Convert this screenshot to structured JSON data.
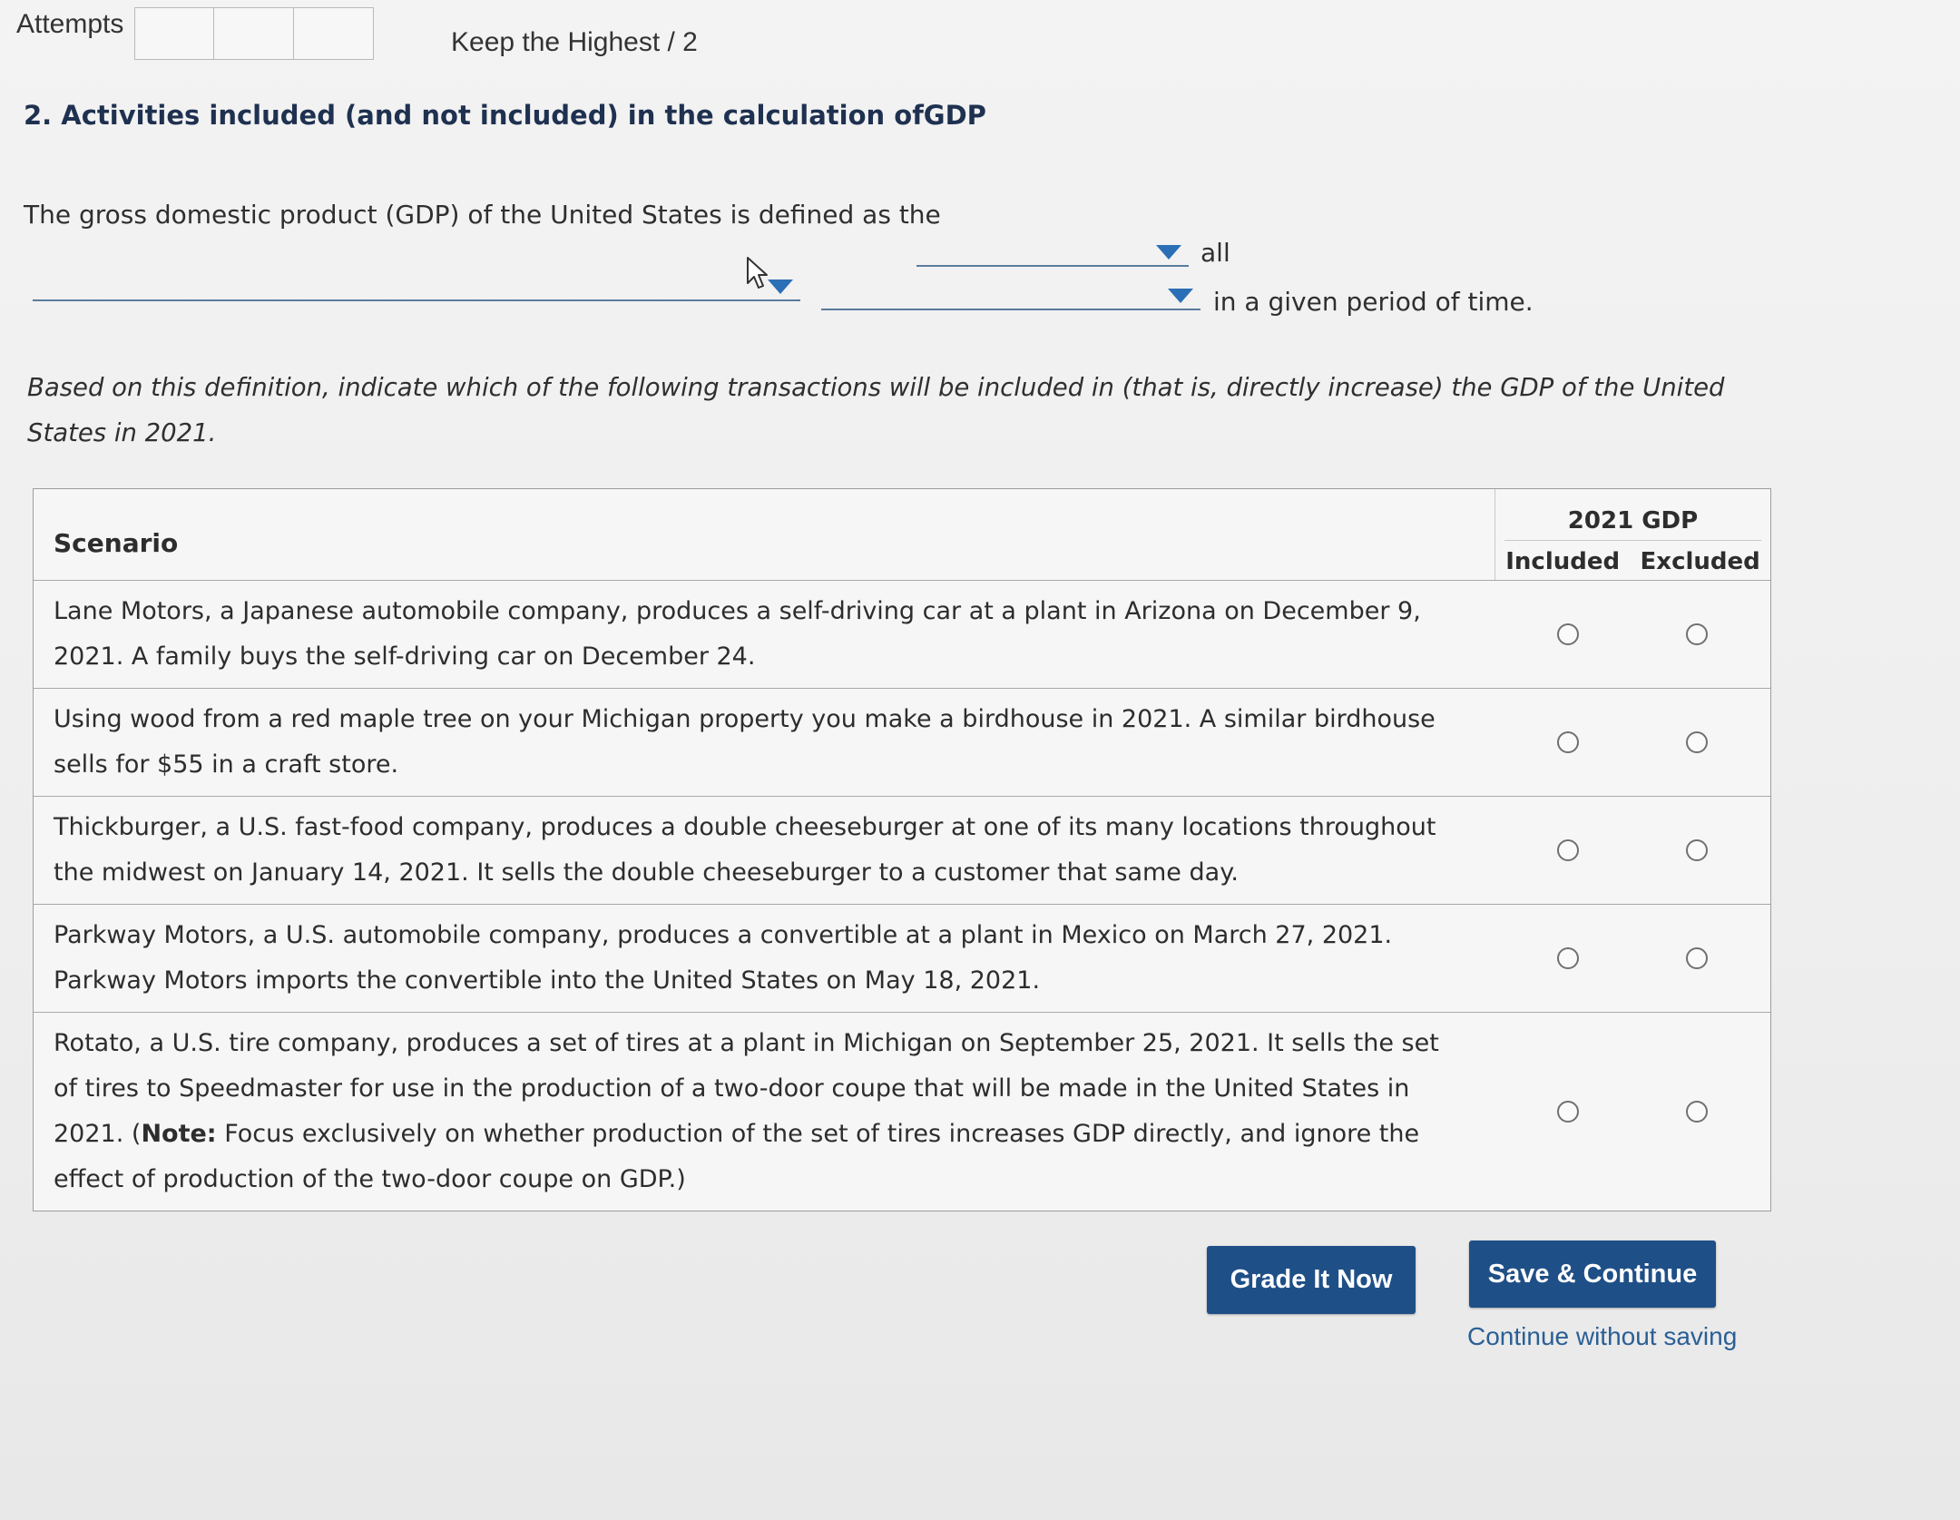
{
  "header": {
    "attempts_label": "Attempts",
    "keep_highest": "Keep the Highest / 2"
  },
  "question": {
    "title": "2. Activities included (and not included) in the calculation ofGDP",
    "definition": {
      "lead": "The gross domestic product (GDP) of the United States is defined as the",
      "word_all": "all",
      "tail": "in a given period of time."
    },
    "instruction": "Based on this definition, indicate which of the following transactions will be included in (that is, directly increase) the GDP of the United States in 2021."
  },
  "table": {
    "col_scenario": "Scenario",
    "col_group": "2021 GDP",
    "col_included": "Included",
    "col_excluded": "Excluded",
    "rows": [
      {
        "text": "Lane Motors, a Japanese automobile company, produces a self-driving car at a plant in Arizona on December 9, 2021. A family buys the self-driving car on December 24."
      },
      {
        "text": "Using wood from a red maple tree on your Michigan property you make a birdhouse in 2021. A similar birdhouse sells for $55 in a craft store."
      },
      {
        "text": "Thickburger, a U.S. fast-food company, produces a double cheeseburger at one of its many locations throughout the midwest on January 14, 2021. It sells the double cheeseburger to a customer that same day."
      },
      {
        "text": "Parkway Motors, a U.S. automobile company, produces a convertible at a plant in Mexico on March 27, 2021. Parkway Motors imports the convertible into the United States on May 18, 2021."
      },
      {
        "text": "Rotato, a U.S. tire company, produces a set of tires at a plant in Michigan on September 25, 2021. It sells the set of tires to Speedmaster for use in the production of a two-door coupe that will be made in the United States in 2021.",
        "note_open": "(",
        "note_label": "Note:",
        "note_text": " Focus exclusively on whether production of the set of tires increases GDP directly, and ignore the effect of production of the two-door coupe on GDP.)"
      }
    ]
  },
  "actions": {
    "grade_label": "Grade It Now",
    "save_label": "Save & Continue",
    "continue_label": "Continue without saving"
  },
  "colors": {
    "button_bg": "#1f4f87",
    "title": "#1f3150",
    "dropdown_caret": "#2b6fb6",
    "link": "#2a5f95"
  }
}
